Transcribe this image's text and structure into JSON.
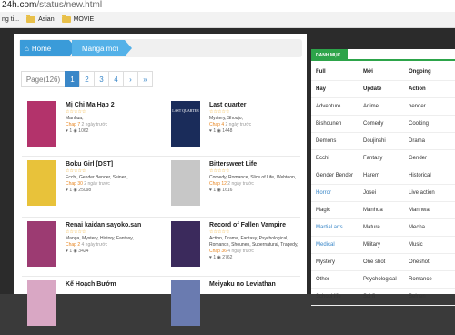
{
  "browser": {
    "url_host": "24h.com",
    "url_path": "/status/new.html",
    "bookmarks": [
      {
        "label": "ng ti..."
      },
      {
        "label": "Asian"
      },
      {
        "label": "MOVIE"
      }
    ]
  },
  "breadcrumb": {
    "home": "Home",
    "current": "Manga mới"
  },
  "pager": {
    "count": "Page(126)",
    "pages": [
      "1",
      "2",
      "3",
      "4"
    ],
    "next": "›",
    "last": "»",
    "active": "1"
  },
  "items": [
    {
      "title": "Mị Chi Ma Hạp 2",
      "genres": "Manhua,",
      "chap": "Chap 7",
      "date": "2 ngày trước",
      "likes": "1",
      "views": "1062",
      "stars": "☆☆☆☆☆",
      "cover_color": "#b3336b"
    },
    {
      "title": "Last quarter",
      "genres": "Mystery, Shoujo,",
      "chap": "Chap 4",
      "date": "2 ngày trước",
      "likes": "1",
      "views": "1448",
      "stars": "☆☆☆☆☆",
      "cover_color": "#1a2c5a",
      "cover_text": "LAST QUARTER"
    },
    {
      "title": "Boku Girl [DST]",
      "genres": "Ecchi, Gender Bender, Seinen,",
      "chap": "Chap 30",
      "date": "2 ngày trước",
      "likes": "1",
      "views": "25098",
      "stars": "☆☆☆☆☆",
      "cover_color": "#e8c23a"
    },
    {
      "title": "Bittersweet Life",
      "genres": "Comedy, Romance, Slice of Life, Webtoon,",
      "chap": "Chap 12",
      "date": "2 ngày trước",
      "likes": "1",
      "views": "1616",
      "stars": "☆☆☆☆☆",
      "cover_color": "#c7c7c7"
    },
    {
      "title": "Renai kaidan sayoko.san",
      "genres": "Manga, Mystery, History, Fantasy,",
      "chap": "Chap 2",
      "date": "4 ngày trước",
      "likes": "1",
      "views": "3424",
      "stars": "☆☆☆☆☆",
      "cover_color": "#9c3b72"
    },
    {
      "title": "Record of Fallen Vampire",
      "genres": "Action, Drama, Fantasy, Psychological, Romance, Shounen, Supernatural, Tragedy,",
      "chap": "Chap 36",
      "date": "4 ngày trước",
      "likes": "1",
      "views": "2762",
      "stars": "☆☆☆☆☆",
      "cover_color": "#3b2a5c"
    },
    {
      "title": "Kế Hoạch Bướm",
      "genres": "",
      "chap": "",
      "date": "",
      "likes": "",
      "views": "",
      "stars": "",
      "cover_color": "#d9a7c4"
    },
    {
      "title": "Meiyaku no Leviathan",
      "genres": "",
      "chap": "",
      "date": "",
      "likes": "",
      "views": "",
      "stars": "",
      "cover_color": "#6a7bb0"
    }
  ],
  "sidebar": {
    "title": "DANH MỤC",
    "rows": [
      [
        "Full",
        "Mới",
        "Ongoing"
      ],
      [
        "Hay",
        "Update",
        "Action"
      ],
      [
        "Adventure",
        "Anime",
        "bender"
      ],
      [
        "Bishounen",
        "Comedy",
        "Cooking"
      ],
      [
        "Demons",
        "Doujinshi",
        "Drama"
      ],
      [
        "Ecchi",
        "Fantasy",
        "Gender"
      ],
      [
        "Gender Bender",
        "Harem",
        "Historical"
      ],
      [
        "Horror",
        "Josei",
        "Live action"
      ],
      [
        "Magic",
        "Manhua",
        "Manhwa"
      ],
      [
        "Martial arts",
        "Mature",
        "Mecha"
      ],
      [
        "Medical",
        "Military",
        "Music"
      ],
      [
        "Mystery",
        "One shot",
        "Oneshot"
      ],
      [
        "Other",
        "Psychological",
        "Romance"
      ],
      [
        "School life",
        "Sci fi",
        "Seinen"
      ]
    ]
  },
  "colors": {
    "accent_blue": "#3a87c8",
    "accent_green": "#2da44a",
    "chap_orange": "#e8851f"
  }
}
